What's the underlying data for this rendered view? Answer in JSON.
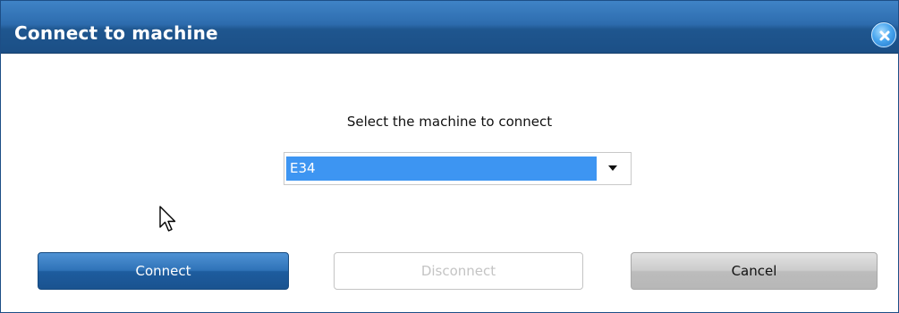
{
  "dialog": {
    "title": "Connect to machine",
    "close_icon": "close-icon",
    "prompt": "Select the machine to connect",
    "machine_select": {
      "selected_value": "E34",
      "arrow_icon": "dropdown-arrow-icon"
    },
    "buttons": {
      "connect": "Connect",
      "disconnect": "Disconnect",
      "cancel": "Cancel"
    },
    "states": {
      "disconnect_enabled": false
    }
  },
  "colors": {
    "titlebar": "#2d6cae",
    "selection_highlight": "#3d95f2",
    "connect_button": "#2f73b8",
    "cancel_button": "#c6c6c6",
    "disabled_text": "#c4c4c4"
  }
}
